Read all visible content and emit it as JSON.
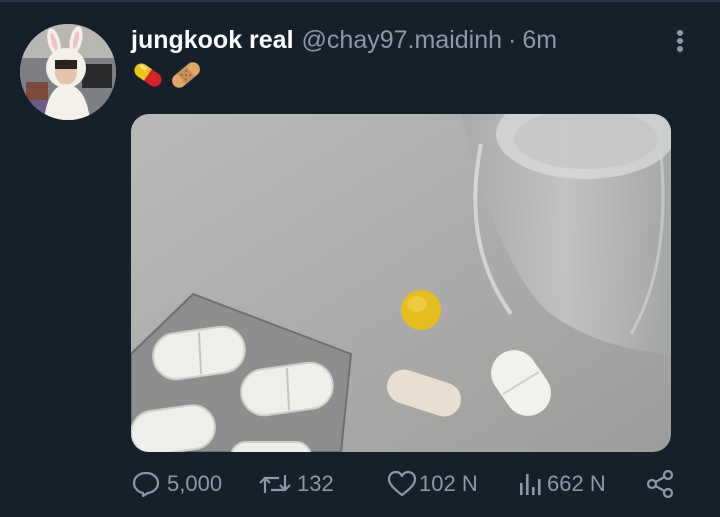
{
  "tweet": {
    "display_name": "jungkook real",
    "handle": "@chay97.maidinh",
    "separator": "·",
    "time": "6m",
    "emojis": [
      "pill-emoji",
      "bandage-emoji"
    ],
    "avatar_icon": "user-avatar-bunny-hood",
    "media_description_icon": "pills-and-glass-photo"
  },
  "actions": {
    "replies": "5,000",
    "retweets": "132",
    "likes": "102 N",
    "views": "662 N"
  },
  "colors": {
    "background": "#15202b",
    "text_primary": "#ffffff",
    "text_secondary": "#8b98a5"
  }
}
